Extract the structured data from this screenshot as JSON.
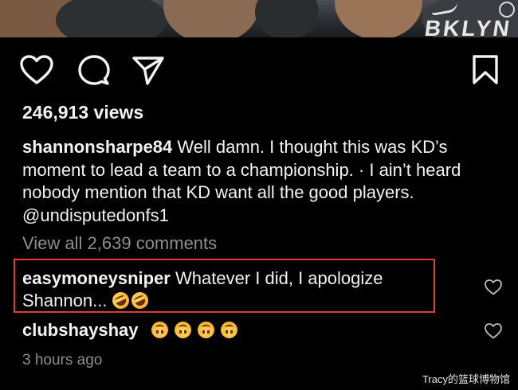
{
  "photo": {
    "jersey_text": "BKLYN"
  },
  "actions": {
    "icons": [
      "heart-icon",
      "comment-icon",
      "share-icon",
      "bookmark-icon"
    ]
  },
  "post": {
    "views": "246,913 views",
    "caption_user": "shannonsharpe84",
    "caption_text": "Well damn. I thought this was KD’s moment to lead a team to a championship. · I ain’t heard nobody mention that KD want all the good players. @undisputedonfs1",
    "view_all_comments": "View all 2,639 comments"
  },
  "comments": [
    {
      "user": "easymoneysniper",
      "text": "Whatever I did, I apologize Shannon...",
      "emoji": [
        "rolling-on-floor-laughing",
        "rolling-on-floor-laughing"
      ],
      "highlighted": true,
      "highlight_color": "#d9412d"
    },
    {
      "user": "clubshayshay",
      "text": "",
      "emoji": [
        "upside-down-face",
        "upside-down-face",
        "upside-down-face",
        "upside-down-face"
      ],
      "highlighted": false
    }
  ],
  "timestamp": "3 hours ago",
  "watermark": "Tracy的篮球博物馆",
  "colors": {
    "background": "#000000",
    "text": "#f2f2f2",
    "muted": "#8e8e8e",
    "highlight": "#d9412d"
  }
}
